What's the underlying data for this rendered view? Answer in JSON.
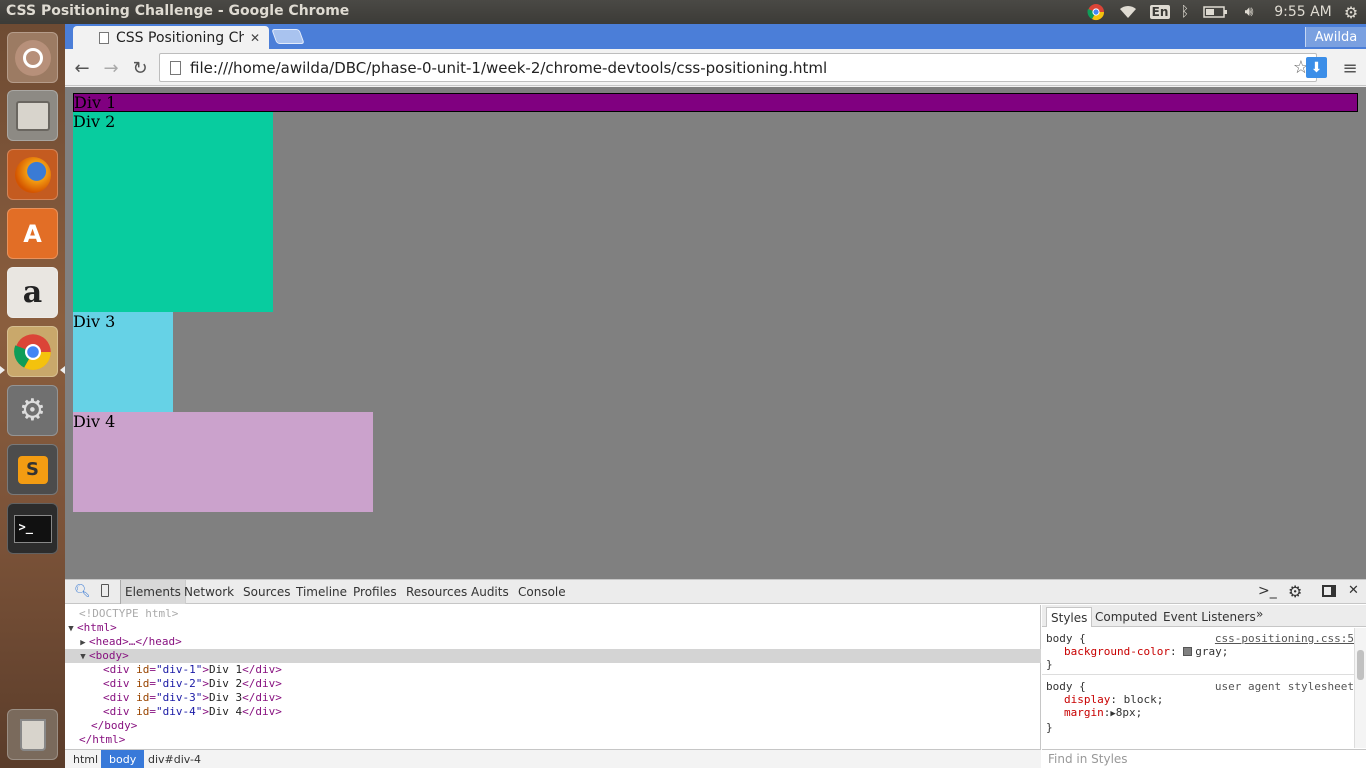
{
  "os_panel": {
    "window_title": "CSS Positioning Challenge - Google Chrome",
    "language": "En",
    "clock": "9:55 AM"
  },
  "launcher": {
    "items": [
      "ubuntu-dash",
      "files",
      "firefox",
      "software-center",
      "amazon",
      "chrome",
      "system-settings",
      "sublime-text",
      "terminal",
      "trash"
    ]
  },
  "browser": {
    "tab_title": "CSS Positioning Challenge",
    "profile_name": "Awilda",
    "url": "file:///home/awilda/DBC/phase-0-unit-1/week-2/chrome-devtools/css-positioning.html"
  },
  "page": {
    "divs": [
      "Div 1",
      "Div 2",
      "Div 3",
      "Div 4"
    ],
    "colors": {
      "body": "#808080",
      "div1": "#800080",
      "div2": "#08cc9f",
      "div3": "#66d2e6",
      "div4": "#cba2cc"
    }
  },
  "devtools": {
    "tabs": [
      "Elements",
      "Network",
      "Sources",
      "Timeline",
      "Profiles",
      "Resources",
      "Audits",
      "Console"
    ],
    "selected_tab": "Elements",
    "dom_lines": [
      {
        "text": "<!DOCTYPE html>"
      },
      {
        "open_tag": "<html>"
      },
      {
        "collapsed": "<head>…</head>"
      },
      {
        "open_tag": "<body>"
      },
      {
        "id": "div-1",
        "content": "Div 1"
      },
      {
        "id": "div-2",
        "content": "Div 2"
      },
      {
        "id": "div-3",
        "content": "Div 3"
      },
      {
        "id": "div-4",
        "content": "Div 4"
      },
      {
        "close_tag": "</body>"
      },
      {
        "close_tag": "</html>"
      }
    ],
    "breadcrumbs": [
      "html",
      "body",
      "div#div-4"
    ],
    "styles_tabs": [
      "Styles",
      "Computed",
      "Event Listeners"
    ],
    "styles_more": "»",
    "rules": [
      {
        "selector": "body {",
        "source": "css-positioning.css:5",
        "props": [
          {
            "name": "background-color",
            "value": "gray;"
          }
        ],
        "close": "}"
      },
      {
        "selector": "body {",
        "source": "user agent stylesheet",
        "props": [
          {
            "name": "display",
            "value": "block;"
          },
          {
            "name": "margin",
            "value": "8px;"
          }
        ],
        "close": "}"
      }
    ],
    "find_placeholder": "Find in Styles"
  }
}
